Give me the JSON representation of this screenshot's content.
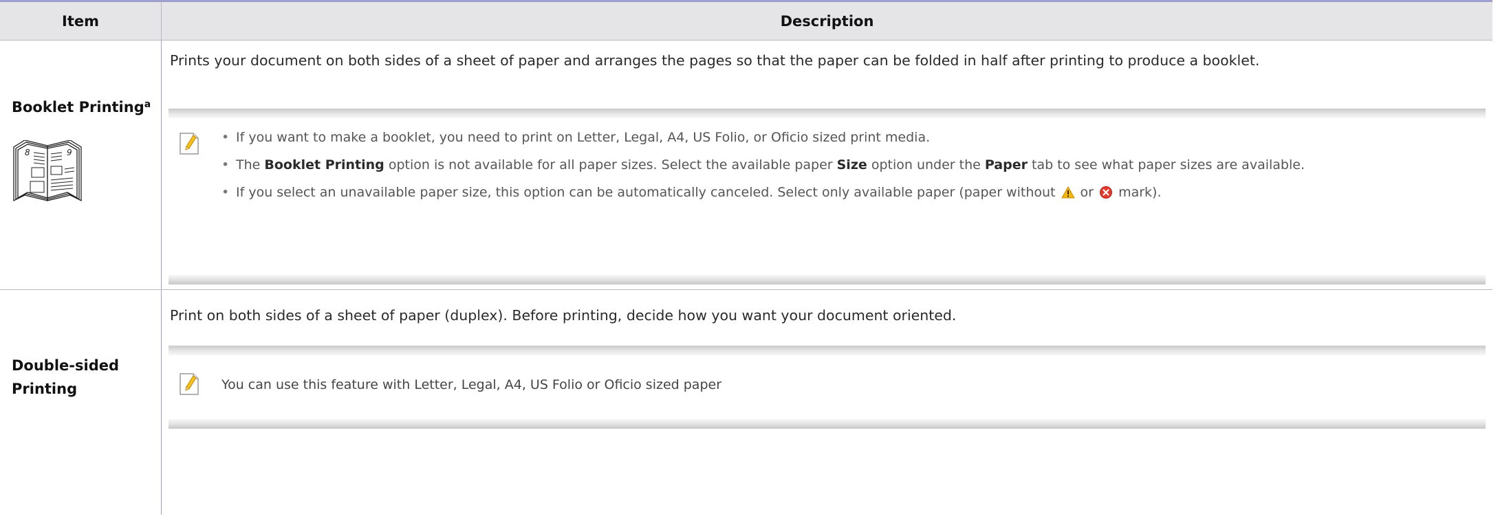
{
  "table": {
    "header": {
      "item": "Item",
      "description": "Description"
    },
    "rows": [
      {
        "title": "Booklet Printing",
        "footnote": "a",
        "description": "Prints your document on both sides of a sheet of paper and arranges the pages so that the paper can be folded in half after printing to produce a booklet.",
        "note": {
          "bullet1": "If you want to make a booklet, you need to print on Letter, Legal, A4, US Folio, or Oficio sized print media.",
          "bullet2": {
            "t1": "The ",
            "b1": "Booklet Printing",
            "t2": " option is not available for all paper sizes. Select the available paper ",
            "b2": "Size",
            "t3": " option under the ",
            "b3": "Paper",
            "t4": " tab to see what paper sizes are available."
          },
          "bullet3": {
            "t1": "If you select an unavailable paper size, this option can be automatically canceled. Select only available paper (paper without ",
            "t2": " or ",
            "t3": " mark)."
          }
        },
        "illustration": {
          "page_left": "8",
          "page_right": "9"
        }
      },
      {
        "title_line1": "Double-sided",
        "title_line2": "Printing",
        "description": "Print on both sides of a sheet of paper (duplex). Before printing, decide how you want your document oriented.",
        "note": {
          "text": "You can use this feature with Letter, Legal, A4, US Folio or Oficio sized paper"
        }
      }
    ]
  }
}
